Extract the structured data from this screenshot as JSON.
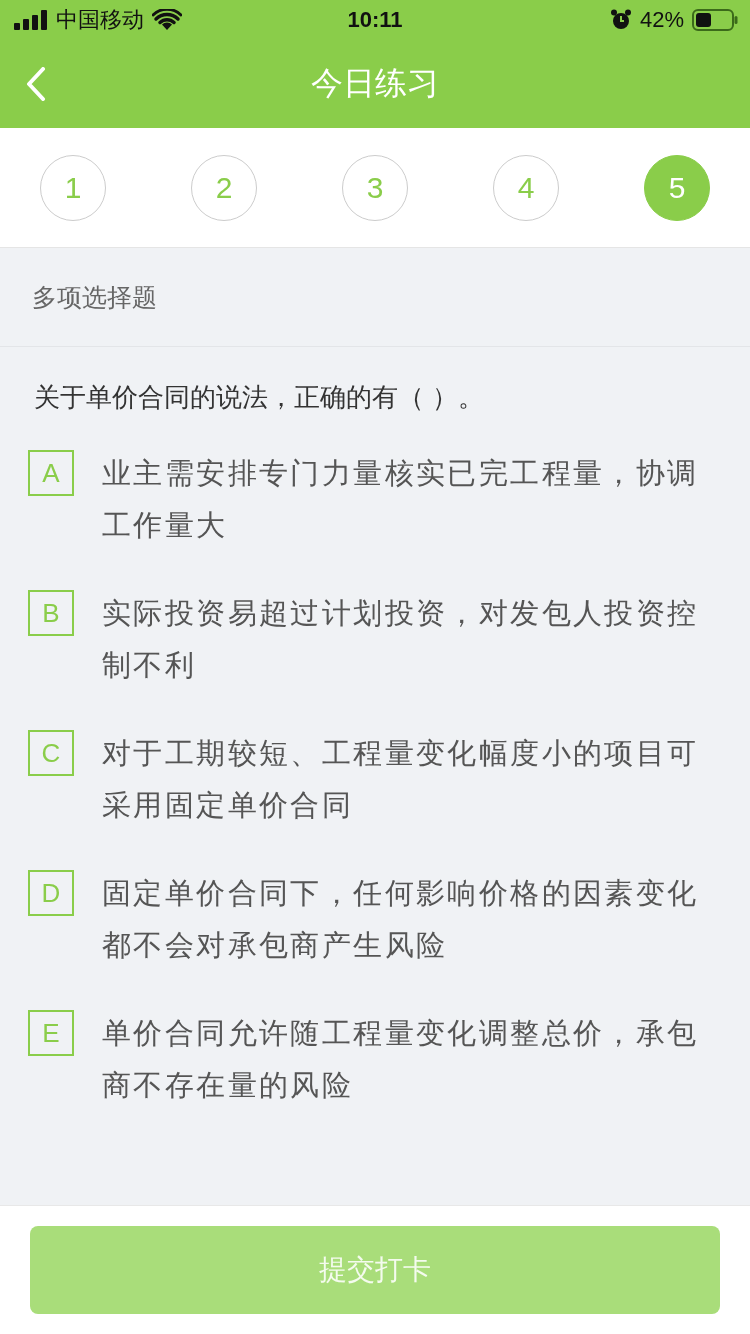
{
  "status_bar": {
    "carrier": "中国移动",
    "time": "10:11",
    "battery": "42%"
  },
  "nav": {
    "title": "今日练习"
  },
  "steps": [
    {
      "label": "1",
      "selected": false
    },
    {
      "label": "2",
      "selected": false
    },
    {
      "label": "3",
      "selected": false
    },
    {
      "label": "4",
      "selected": false
    },
    {
      "label": "5",
      "selected": true
    }
  ],
  "question_type": "多项选择题",
  "question": "关于单价合同的说法，正确的有（    ）。",
  "options": [
    {
      "letter": "A",
      "text": "业主需安排专门力量核实已完工程量，协调工作量大",
      "selected": false
    },
    {
      "letter": "B",
      "text": "实际投资易超过计划投资，对发包人投资控制不利",
      "selected": false
    },
    {
      "letter": "C",
      "text": "对于工期较短、工程量变化幅度小的项目可采用固定单价合同",
      "selected": false
    },
    {
      "letter": "D",
      "text": "固定单价合同下，任何影响价格的因素变化都不会对承包商产生风险",
      "selected": false
    },
    {
      "letter": "E",
      "text": "单价合同允许随工程量变化调整总价，承包商不存在量的风险",
      "selected": false
    }
  ],
  "submit": {
    "label": "提交打卡",
    "disabled": true
  }
}
